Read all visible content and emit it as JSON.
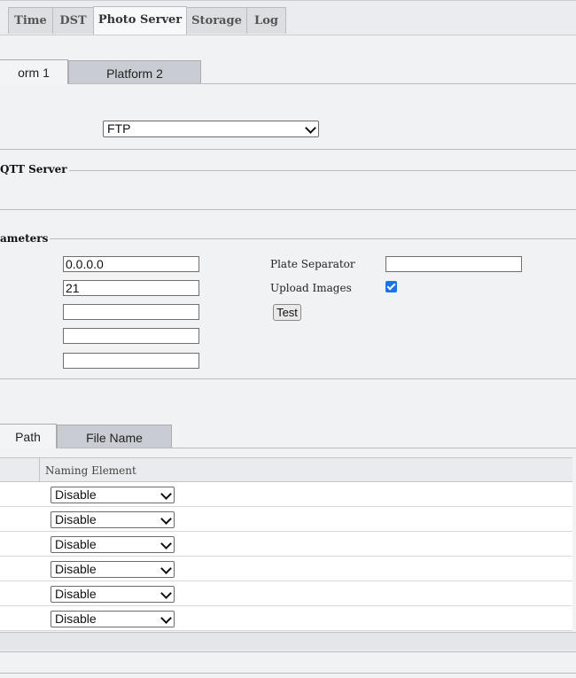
{
  "top_tabs": [
    {
      "label": "Time",
      "active": false
    },
    {
      "label": "DST",
      "active": false
    },
    {
      "label": "Photo Server",
      "active": true
    },
    {
      "label": "Storage",
      "active": false
    },
    {
      "label": "Log",
      "active": false
    }
  ],
  "platform_tabs": [
    {
      "label": "orm 1",
      "active": true
    },
    {
      "label": "Platform 2",
      "active": false
    }
  ],
  "protocol_select": {
    "value": "FTP"
  },
  "group_mqtt": {
    "title": "QTT Server"
  },
  "group_params": {
    "title": "ameters"
  },
  "params": {
    "inputs": [
      "0.0.0.0",
      "21",
      "",
      "",
      ""
    ],
    "plate_separator_label": "Plate Separator",
    "plate_separator_value": "",
    "upload_images_label": "Upload Images",
    "upload_images_checked": true,
    "test_button": "Test"
  },
  "path_tabs": [
    {
      "label": "Path",
      "active": true
    },
    {
      "label": "File Name",
      "active": false
    }
  ],
  "table": {
    "header": "Naming Element",
    "rows": [
      "Disable",
      "Disable",
      "Disable",
      "Disable",
      "Disable",
      "Disable"
    ]
  },
  "colors": {
    "checkbox": "#1a73e8",
    "background": "#f1f2f4"
  }
}
